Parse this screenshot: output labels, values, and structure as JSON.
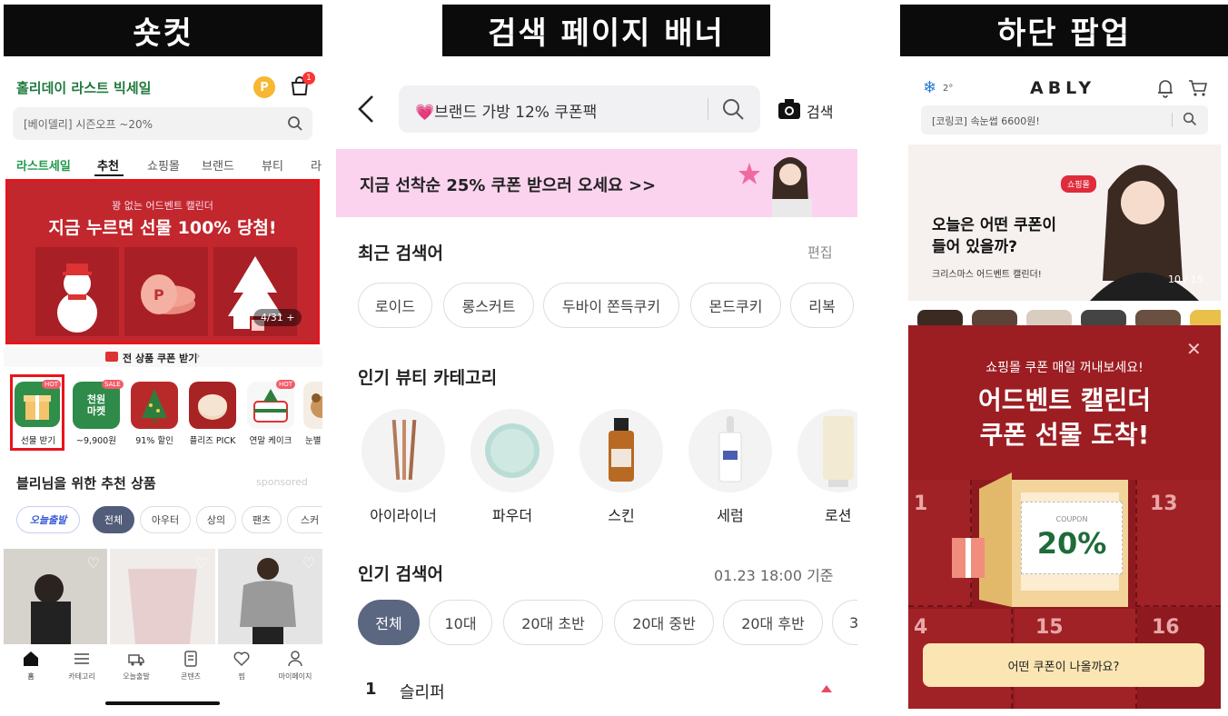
{
  "titles": {
    "left": "숏컷",
    "mid": "검색 페이지 배너",
    "right": "하단 팝업"
  },
  "left": {
    "store_name": "홀리데이 라스트 빅세일",
    "point_badge": "P",
    "cart_count": "1",
    "search_placeholder": "[베이델리] 시즌오프 ~20%",
    "tabs": [
      "라스트세일",
      "추천",
      "쇼핑몰",
      "브랜드",
      "뷰티",
      "라"
    ],
    "banner_sub": "꽝 없는 어드벤트 캘린더",
    "banner_title": "지금 누르면 선물 100% 당첨!",
    "banner_counter": "4/31 +",
    "coupon_strip": "전 상품 쿠폰 받기",
    "shortcuts": [
      {
        "label": "선물 받기",
        "badge": "HOT"
      },
      {
        "label": "~9,900원",
        "badge": "SALE",
        "tile_text": "천원\n마켓"
      },
      {
        "label": "91% 할인",
        "badge": ""
      },
      {
        "label": "플리즈 PICK",
        "badge": ""
      },
      {
        "label": "연말 케이크",
        "badge": "HOT"
      },
      {
        "label": "눈별",
        "badge": ""
      }
    ],
    "rec_title": "블리님을 위한 추천 상품",
    "sponsored": "sponsored",
    "chips": [
      "오늘출발",
      "전체",
      "아우터",
      "상의",
      "팬츠",
      "스커"
    ],
    "bottom_nav": [
      "홈",
      "카테고리",
      "오늘출발",
      "콘텐츠",
      "찜",
      "마이페이지"
    ]
  },
  "mid": {
    "search_text": "💗브랜드 가방 12% 쿠폰팩",
    "search_button": "검색",
    "banner_text": "지금 선착순 25% 쿠폰 받으러 오세요 >>",
    "recent_title": "최근 검색어",
    "edit": "편집",
    "recent_chips": [
      "로이드",
      "롱스커트",
      "두바이 쫀득쿠키",
      "몬드쿠키",
      "리복"
    ],
    "beauty_title": "인기 뷰티 카테고리",
    "beauty_items": [
      "아이라이너",
      "파우더",
      "스킨",
      "세럼",
      "로션"
    ],
    "popular_title": "인기 검색어",
    "popular_time": "01.23 18:00 기준",
    "age_chips": [
      "전체",
      "10대",
      "20대 초반",
      "20대 중반",
      "20대 후반",
      "3"
    ],
    "rank_num": "1",
    "rank_word": "슬리퍼"
  },
  "right": {
    "weather": "2°",
    "logo": "ABLY",
    "search_placeholder": "[코링코] 속눈썹 6600원!",
    "banner_title": "오늘은 어떤 쿠폰이\n들어 있을까?",
    "banner_sub": "크리스마스 어드벤트 캘린더!",
    "banner_tag": "쇼핑몰",
    "banner_counter": "10 / 15",
    "popup_sub": "쇼핑몰 쿠폰 매일 꺼내보세요!",
    "popup_title": "어드벤트 캘린더\n쿠폰 선물 도착!",
    "coupon_label": "COUPON",
    "coupon_value": "20%",
    "day_numbers": [
      "1",
      "13",
      "4",
      "15",
      "16"
    ],
    "popup_button": "어떤 쿠폰이 나올까요?"
  }
}
